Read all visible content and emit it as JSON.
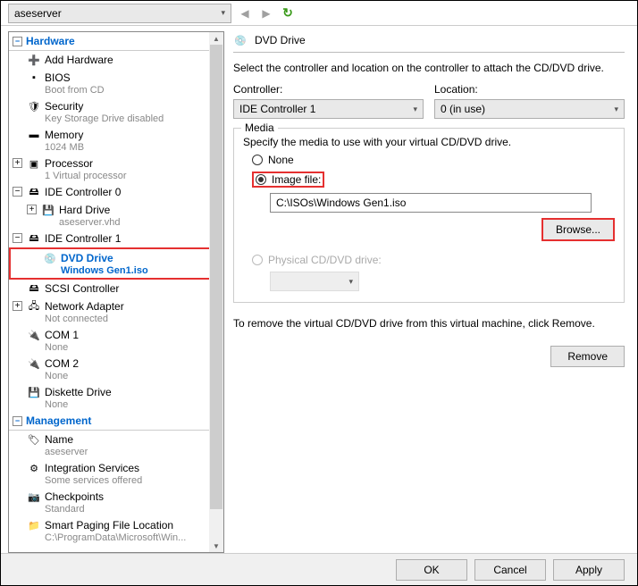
{
  "topbar": {
    "vm_name": "aseserver"
  },
  "sidebar": {
    "hardware_label": "Hardware",
    "management_label": "Management",
    "items": {
      "add_hardware": "Add Hardware",
      "bios": "BIOS",
      "bios_sub": "Boot from CD",
      "security": "Security",
      "security_sub": "Key Storage Drive disabled",
      "memory": "Memory",
      "memory_sub": "1024 MB",
      "processor": "Processor",
      "processor_sub": "1 Virtual processor",
      "ide0": "IDE Controller 0",
      "hard_drive": "Hard Drive",
      "hard_drive_sub": "aseserver.vhd",
      "ide1": "IDE Controller 1",
      "dvd_drive": "DVD Drive",
      "dvd_drive_sub": "Windows Gen1.iso",
      "scsi": "SCSI Controller",
      "network": "Network Adapter",
      "network_sub": "Not connected",
      "com1": "COM 1",
      "com1_sub": "None",
      "com2": "COM 2",
      "com2_sub": "None",
      "diskette": "Diskette Drive",
      "diskette_sub": "None",
      "name": "Name",
      "name_sub": "aseserver",
      "integration": "Integration Services",
      "integration_sub": "Some services offered",
      "checkpoints": "Checkpoints",
      "checkpoints_sub": "Standard",
      "paging": "Smart Paging File Location",
      "paging_sub": "C:\\ProgramData\\Microsoft\\Win..."
    }
  },
  "content": {
    "title": "DVD Drive",
    "description": "Select the controller and location on the controller to attach the CD/DVD drive.",
    "controller_label": "Controller:",
    "controller_value": "IDE Controller 1",
    "location_label": "Location:",
    "location_value": "0 (in use)",
    "media_legend": "Media",
    "media_desc": "Specify the media to use with your virtual CD/DVD drive.",
    "radio_none": "None",
    "radio_image": "Image file:",
    "image_path": "C:\\ISOs\\Windows Gen1.iso",
    "browse": "Browse...",
    "radio_physical": "Physical CD/DVD drive:",
    "remove_desc": "To remove the virtual CD/DVD drive from this virtual machine, click Remove.",
    "remove": "Remove"
  },
  "footer": {
    "ok": "OK",
    "cancel": "Cancel",
    "apply": "Apply"
  }
}
